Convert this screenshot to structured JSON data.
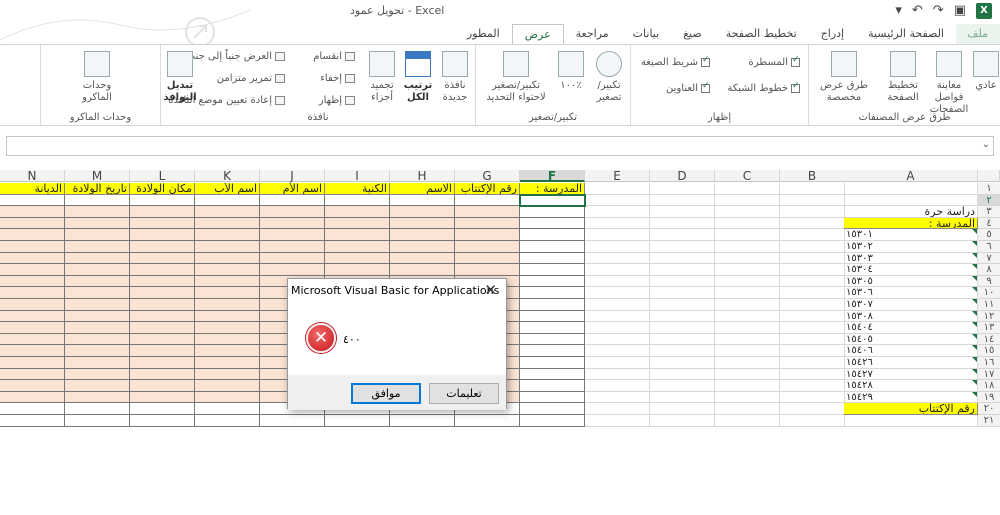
{
  "window": {
    "title": "تحويل عمود - Excel",
    "qat_icons": [
      "ribbon-options-icon",
      "undo-icon",
      "redo-icon",
      "save-icon",
      "excel-logo-icon"
    ]
  },
  "tabs": [
    {
      "label": "ملف",
      "active": false
    },
    {
      "label": "الصفحة الرئيسية",
      "active": false
    },
    {
      "label": "إدراج",
      "active": false
    },
    {
      "label": "تخطيط الصفحة",
      "active": false
    },
    {
      "label": "صيغ",
      "active": false
    },
    {
      "label": "بيانات",
      "active": false
    },
    {
      "label": "مراجعة",
      "active": false
    },
    {
      "label": "عرض",
      "active": true
    },
    {
      "label": "المطور",
      "active": false
    }
  ],
  "ribbon": {
    "workbook_views": {
      "group": "طرق عرض المصنفات",
      "normal": "عادي",
      "page_break": "معاينة فواصل الصفحات",
      "page_layout": "تخطيط الصفحة",
      "custom": "طرق عرض مخصصة"
    },
    "show": {
      "group": "إظهار",
      "ruler": "المسطرة",
      "formula_bar": "شريط الصيغة",
      "gridlines": "خطوط الشبكة",
      "headings": "العناوين"
    },
    "zoom": {
      "group": "تكبير/تصغير",
      "zoom": "تكبير/ تصغير",
      "hundred": "١٠٠٪",
      "to_selection": "تكبير/تصغير لاحتواء التحديد"
    },
    "window": {
      "group": "نافذة",
      "new_window": "نافذة جديدة",
      "arrange_all": "ترتيب الكل",
      "freeze": "تجميد أجزاء",
      "split": "انقسام",
      "hide": "إخفاء",
      "unhide": "إظهار",
      "side_by_side": "العرض جنباً إلى جنب",
      "sync_scroll": "تمرير متزامن",
      "reset_position": "إعادة تعيين موضع النافذة",
      "switch": "تبديل النوافذ"
    },
    "macros": {
      "group": "وحدات الماكرو",
      "macros": "وحدات الماكرو"
    }
  },
  "grid": {
    "columns": [
      "N",
      "M",
      "L",
      "K",
      "J",
      "I",
      "H",
      "G",
      "F",
      "E",
      "D",
      "C",
      "B",
      "A"
    ],
    "selected_column": "F",
    "row_numbers": [
      "١",
      "٢",
      "٣",
      "٤",
      "٥",
      "٦",
      "٧",
      "٨",
      "٩",
      "١٠",
      "١١",
      "١٢",
      "١٣",
      "١٤",
      "١٥",
      "١٦",
      "١٧",
      "١٨",
      "١٩",
      "٢٠",
      "٢١"
    ],
    "selected_row": "٢",
    "header_row": {
      "N": "الديانة",
      "M": "تاريخ الولادة",
      "L": "مكان الولادة",
      "K": "اسم الأب",
      "J": "اسم الأم",
      "I": "الكنية",
      "H": "الاسم",
      "G": "رقم الإكتتاب",
      "F": "المدرسة :"
    },
    "column_a": {
      "row3": "دراسة حرة",
      "row4": "المدرسة :",
      "codes": [
        "١٥٣٠١",
        "١٥٣٠٢",
        "١٥٣٠٣",
        "١٥٣٠٤",
        "١٥٣٠٥",
        "١٥٣٠٦",
        "١٥٣٠٧",
        "١٥٣٠٨",
        "١٥٤٠٤",
        "١٥٤٠٥",
        "١٥٤٠٦",
        "١٥٤٢٦",
        "١٥٤٢٧",
        "١٥٤٢٨",
        "١٥٤٢٩"
      ],
      "row20": "رقم الإكتتاب"
    }
  },
  "dialog": {
    "title": "Microsoft Visual Basic for Applications",
    "message": "٤٠٠",
    "ok_label": "موافق",
    "help_label": "تعليمات"
  },
  "colors": {
    "accent": "#217346",
    "header_fill": "#ffff00",
    "table_fill": "#fbe4d5"
  }
}
